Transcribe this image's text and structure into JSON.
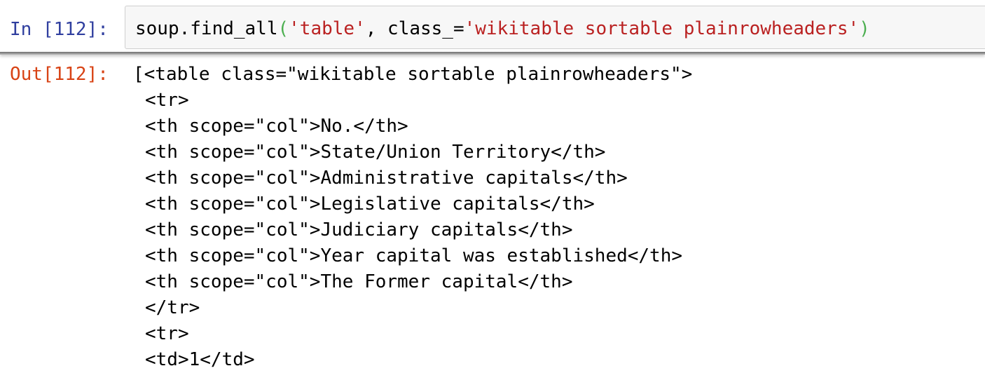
{
  "input_cell": {
    "prompt": "In [112]:",
    "code_prefix": "soup.find_all",
    "open_paren": "(",
    "arg1": "'table'",
    "separator": ", class_=",
    "arg2": "'wikitable sortable plainrowheaders'",
    "close_paren": ")"
  },
  "output_cell": {
    "prompt": "Out[112]:",
    "lines": [
      "[<table class=\"wikitable sortable plainrowheaders\">",
      "<tr>",
      "<th scope=\"col\">No.</th>",
      "<th scope=\"col\">State/Union Territory</th>",
      "<th scope=\"col\">Administrative capitals</th>",
      "<th scope=\"col\">Legislative capitals</th>",
      "<th scope=\"col\">Judiciary capitals</th>",
      "<th scope=\"col\">Year capital was established</th>",
      "<th scope=\"col\">The Former capital</th>",
      "</tr>",
      "<tr>",
      "<td>1</td>"
    ]
  },
  "colors": {
    "in_prompt": "#303f9f",
    "out_prompt": "#d84315",
    "string": "#ba2121",
    "paren": "#4caf50",
    "cell_background": "#f7f7f7"
  }
}
